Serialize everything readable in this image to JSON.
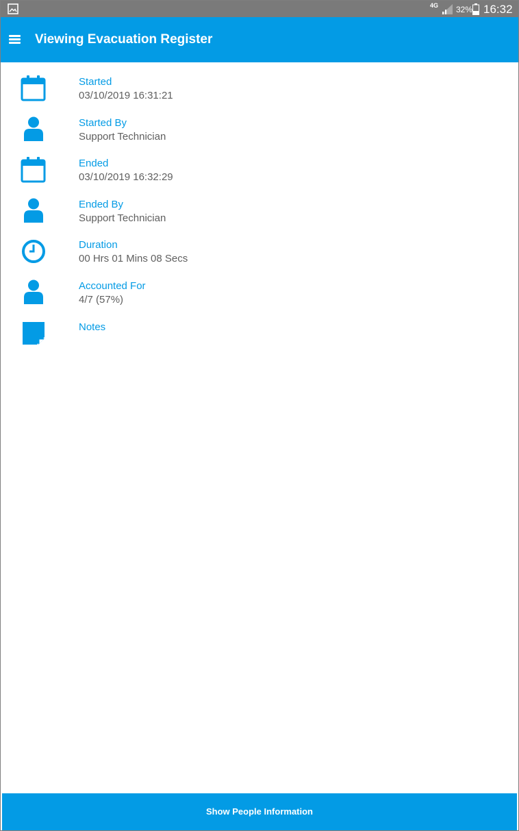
{
  "status_bar": {
    "network": "4G",
    "battery": "32%",
    "time": "16:32"
  },
  "app_bar": {
    "title": "Viewing Evacuation Register"
  },
  "details": [
    {
      "label": "Started",
      "value": "03/10/2019 16:31:21",
      "icon": "calendar-icon"
    },
    {
      "label": "Started By",
      "value": "Support Technician",
      "icon": "person-icon"
    },
    {
      "label": "Ended",
      "value": "03/10/2019 16:32:29",
      "icon": "calendar-icon"
    },
    {
      "label": "Ended By",
      "value": "Support Technician",
      "icon": "person-icon"
    },
    {
      "label": "Duration",
      "value": "00 Hrs 01 Mins 08 Secs",
      "icon": "clock-icon"
    },
    {
      "label": "Accounted For",
      "value": "4/7 (57%)",
      "icon": "person-icon"
    },
    {
      "label": "Notes",
      "value": "",
      "icon": "note-icon"
    }
  ],
  "bottom_button": {
    "label": "Show People Information"
  },
  "colors": {
    "accent": "#039be5",
    "value_text": "#5f5f5f",
    "status_bar": "#7a7a7a"
  }
}
